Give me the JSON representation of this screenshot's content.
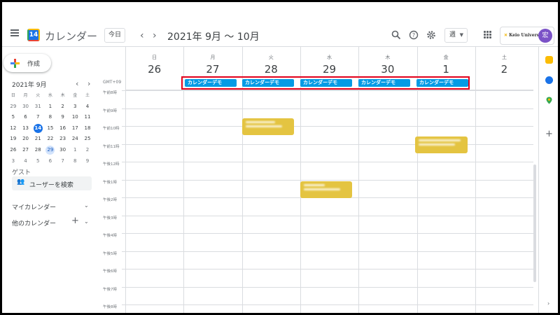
{
  "header": {
    "app_title": "カレンダー",
    "logo_day": "14",
    "today_label": "今日",
    "prev": "‹",
    "next": "›",
    "range": "2021年 9月 ～ 10月",
    "view_label": "週",
    "account_org": "Keio University",
    "avatar_initial": "宏"
  },
  "sidebar": {
    "create_label": "作成",
    "mini_title": "2021年 9月",
    "weekday_headers": [
      "日",
      "月",
      "火",
      "水",
      "木",
      "金",
      "土"
    ],
    "weeks": [
      [
        "29",
        "30",
        "31",
        "1",
        "2",
        "3",
        "4"
      ],
      [
        "5",
        "6",
        "7",
        "8",
        "9",
        "10",
        "11"
      ],
      [
        "12",
        "13",
        "14",
        "15",
        "16",
        "17",
        "18"
      ],
      [
        "19",
        "20",
        "21",
        "22",
        "23",
        "24",
        "25"
      ],
      [
        "26",
        "27",
        "28",
        "29",
        "30",
        "1",
        "2"
      ],
      [
        "3",
        "4",
        "5",
        "6",
        "7",
        "8",
        "9"
      ]
    ],
    "guest_label": "ゲスト",
    "search_user": "ユーザーを検索",
    "my_calendars": "マイカレンダー",
    "other_calendars": "他のカレンダー"
  },
  "week": {
    "gmt": "GMT+09",
    "days": [
      {
        "dow": "日",
        "num": "26"
      },
      {
        "dow": "月",
        "num": "27"
      },
      {
        "dow": "火",
        "num": "28"
      },
      {
        "dow": "水",
        "num": "29"
      },
      {
        "dow": "木",
        "num": "30"
      },
      {
        "dow": "金",
        "num": "1"
      },
      {
        "dow": "土",
        "num": "2"
      }
    ],
    "allday_events": [
      "カレンダーデモ",
      "カレンダーデモ",
      "カレンダーデモ",
      "カレンダーデモ",
      "カレンダーデモ"
    ],
    "hours": [
      "午前8時",
      "午前9時",
      "午前10時",
      "午前11時",
      "午後12時",
      "午後1時",
      "午後2時",
      "午後3時",
      "午後4時",
      "午後5時",
      "午後6時",
      "午後7時",
      "午後8時"
    ]
  },
  "colors": {
    "accent": "#1a73e8",
    "event_blue": "#039be5",
    "event_yellow": "#e4c441",
    "highlight": "#e2001a"
  }
}
